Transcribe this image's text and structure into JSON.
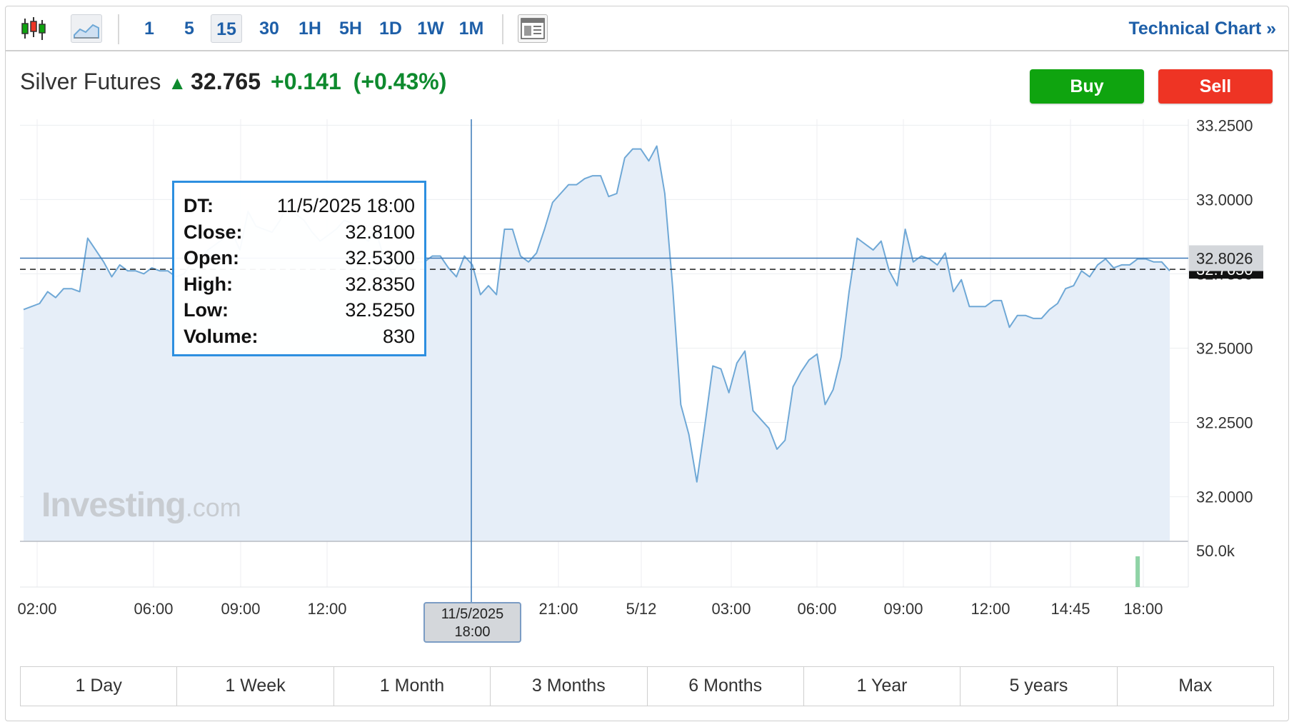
{
  "toolbar": {
    "intervals": [
      "1",
      "5",
      "15",
      "30",
      "1H",
      "5H",
      "1D",
      "1W",
      "1M"
    ],
    "active_interval": "15",
    "technical_chart_label": "Technical Chart »"
  },
  "header": {
    "instrument": "Silver Futures",
    "price": "32.765",
    "change": "+0.141",
    "change_pct": "(+0.43%)"
  },
  "trade": {
    "buy_label": "Buy",
    "sell_label": "Sell"
  },
  "tooltip": {
    "rows": [
      {
        "label": "DT:",
        "value": "11/5/2025 18:00"
      },
      {
        "label": "Close:",
        "value": "32.8100"
      },
      {
        "label": "Open:",
        "value": "32.5300"
      },
      {
        "label": "High:",
        "value": "32.8350"
      },
      {
        "label": "Low:",
        "value": "32.5250"
      },
      {
        "label": "Volume:",
        "value": "830"
      }
    ]
  },
  "crosshair": {
    "date": "11/5/2025",
    "time": "18:00",
    "price_label": "32.8026"
  },
  "watermark": {
    "brand": "Investing",
    "suffix": ".com"
  },
  "ranges": [
    "1 Day",
    "1 Week",
    "1 Month",
    "3 Months",
    "6 Months",
    "1 Year",
    "5 years",
    "Max"
  ],
  "colors": {
    "line": "#6fa8d6",
    "area": "#e6eef8",
    "up": "#0e8a2e",
    "buy": "#0fa40f",
    "sell": "#ee3424",
    "accent": "#1e5fa8"
  },
  "chart_data": {
    "type": "area",
    "title": "",
    "ylim": [
      31.85,
      33.27
    ],
    "yticks": [
      "33.2500",
      "33.0000",
      "32.7500",
      "32.5000",
      "32.2500",
      "32.0000"
    ],
    "xtick_labels": [
      "02:00",
      "06:00",
      "09:00",
      "12:00",
      "21:00",
      "5/12",
      "03:00",
      "06:00",
      "09:00",
      "12:00",
      "14:45",
      "18:00"
    ],
    "volume_tick_label": "50.0k",
    "last_price": "32.7650",
    "last_price_value": 32.765,
    "crosshair_price_value": 32.8026,
    "series": [
      {
        "values": [
          32.63,
          32.64,
          32.65,
          32.69,
          32.67,
          32.7,
          32.7,
          32.69,
          32.87,
          32.83,
          32.79,
          32.74,
          32.78,
          32.76,
          32.76,
          32.75,
          32.77,
          32.76,
          32.76,
          32.74,
          32.75,
          32.79,
          32.79,
          32.83,
          32.85,
          32.87,
          32.89,
          32.83,
          32.96,
          32.91,
          32.9,
          32.89,
          32.93,
          32.99,
          32.95,
          32.93,
          32.89,
          32.86,
          32.88,
          32.9,
          32.93,
          32.92,
          32.88,
          32.86,
          32.89,
          32.8,
          32.75,
          32.79,
          32.78,
          32.79,
          32.79,
          32.81,
          32.81,
          32.77,
          32.74,
          32.81,
          32.78,
          32.68,
          32.71,
          32.68,
          32.9,
          32.9,
          32.81,
          32.79,
          32.82,
          32.9,
          32.99,
          33.02,
          33.05,
          33.05,
          33.07,
          33.08,
          33.08,
          33.01,
          33.02,
          33.14,
          33.17,
          33.17,
          33.13,
          33.18,
          33.02,
          32.7,
          32.31,
          32.21,
          32.05,
          32.24,
          32.44,
          32.43,
          32.35,
          32.45,
          32.49,
          32.29,
          32.26,
          32.23,
          32.16,
          32.19,
          32.37,
          32.42,
          32.46,
          32.48,
          32.31,
          32.36,
          32.47,
          32.69,
          32.87,
          32.85,
          32.83,
          32.86,
          32.76,
          32.71,
          32.9,
          32.79,
          32.81,
          32.8,
          32.78,
          32.82,
          32.69,
          32.73,
          32.64,
          32.64,
          32.64,
          32.66,
          32.66,
          32.57,
          32.61,
          32.61,
          32.6,
          32.6,
          32.63,
          32.65,
          32.7,
          32.71,
          32.76,
          32.74,
          32.78,
          32.8,
          32.77,
          32.78,
          32.78,
          32.8,
          32.8,
          32.79,
          32.79,
          32.76
        ]
      }
    ],
    "volume_values": [
      0,
      0,
      0,
      0,
      0,
      0,
      0,
      0,
      0,
      0,
      0,
      0,
      0,
      0,
      0,
      0,
      0,
      0,
      0,
      0,
      0,
      0,
      0,
      0,
      0,
      0,
      0,
      0,
      0,
      0,
      0,
      0,
      0,
      0,
      0,
      0,
      0,
      0,
      0,
      0,
      0,
      0,
      0,
      0,
      0,
      0,
      0,
      0,
      0,
      0,
      0,
      0,
      0,
      0,
      0,
      0,
      0,
      0,
      0,
      0,
      0,
      0,
      0,
      0,
      0,
      0,
      0,
      0,
      0,
      0,
      0,
      0,
      0,
      0,
      0,
      0,
      0,
      0,
      0,
      0,
      0,
      0,
      0,
      0,
      0,
      0,
      0,
      0,
      0,
      0,
      0,
      0,
      0,
      0,
      0,
      0,
      0,
      0,
      0,
      0,
      0,
      0,
      0,
      0,
      0,
      0,
      0,
      0,
      0,
      0,
      0,
      0,
      0,
      0,
      0,
      0,
      0,
      0,
      0,
      0,
      0,
      0,
      0,
      0,
      0,
      0,
      0,
      0,
      0,
      0,
      0,
      0,
      0,
      0,
      0,
      0,
      0,
      0,
      0,
      42000,
      0,
      0,
      0,
      0
    ]
  }
}
